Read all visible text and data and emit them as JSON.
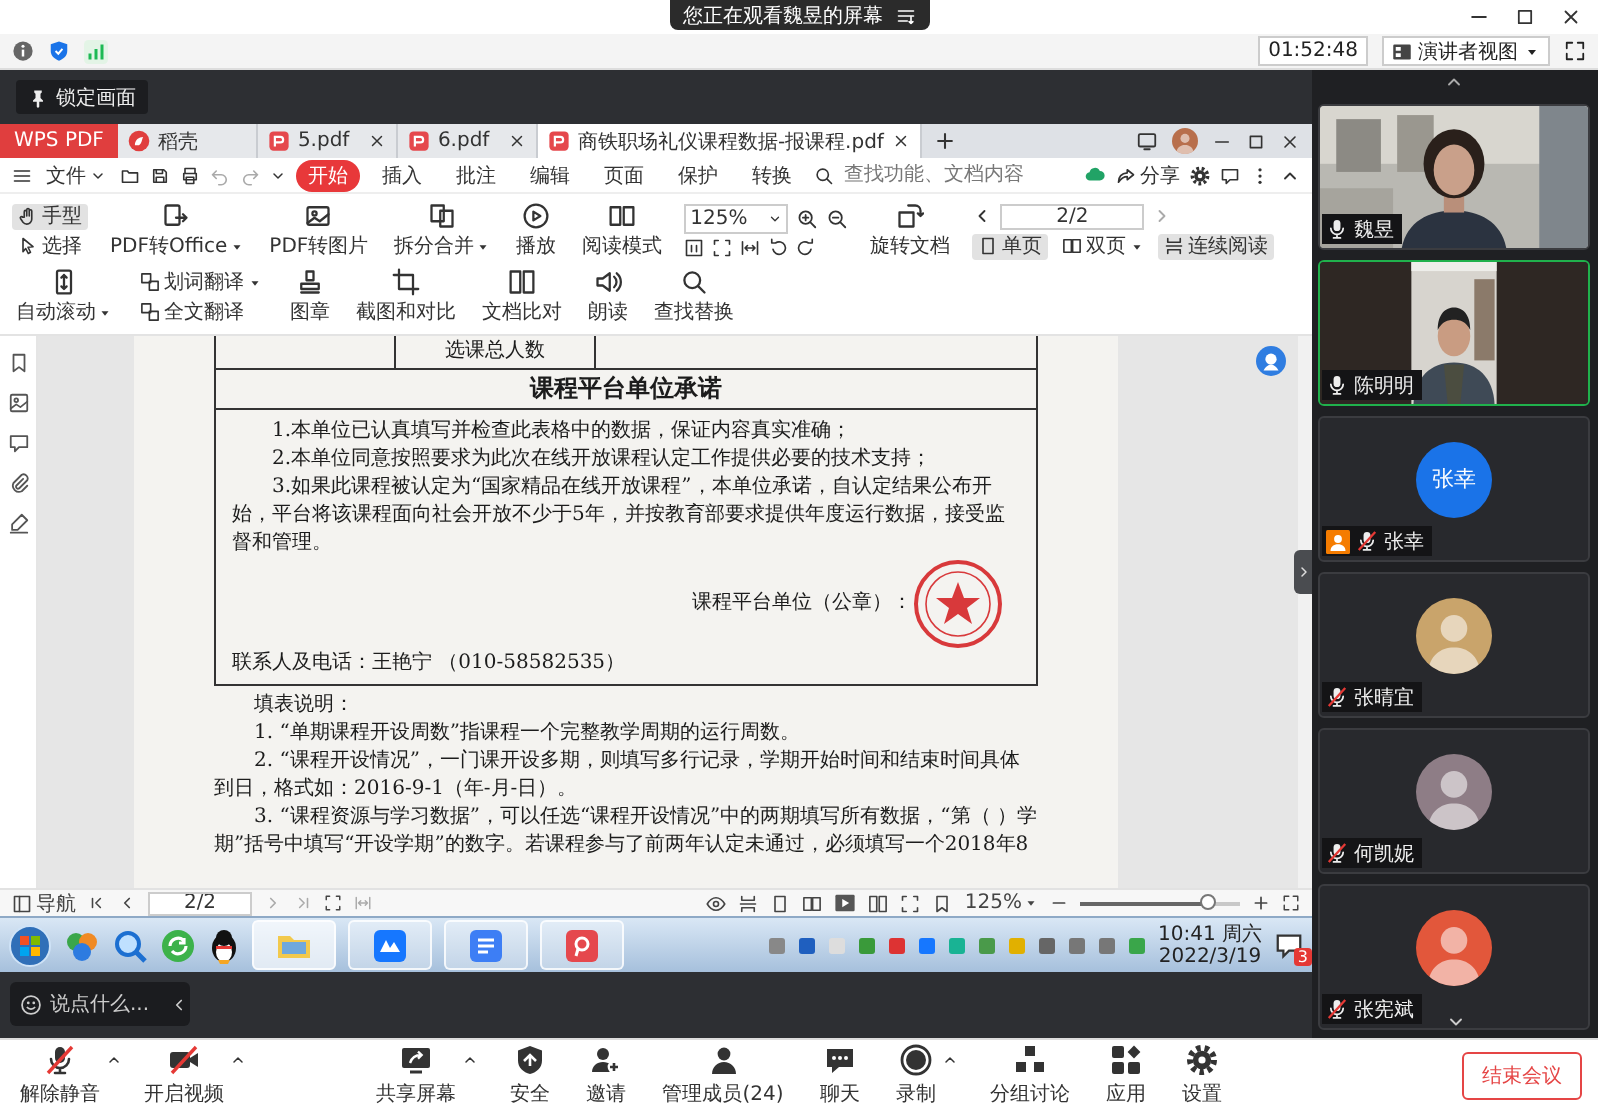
{
  "banner": {
    "text": "您正在观看魏昱的屏幕"
  },
  "meeting_bar": {
    "timer": "01:52:48",
    "view_button": "演讲者视图"
  },
  "pin_button": {
    "label": "锁定画面"
  },
  "shared_screen": {
    "app_button": "WPS PDF",
    "tabs": [
      {
        "label": "稻壳",
        "kind": "store",
        "selected": false
      },
      {
        "label": "5.pdf",
        "kind": "pdf",
        "selected": false
      },
      {
        "label": "6.pdf",
        "kind": "pdf",
        "selected": false
      },
      {
        "label": "商铁职场礼仪课程数据-报课程.pdf",
        "kind": "pdf",
        "selected": true
      }
    ],
    "file_menu": "文件",
    "menu": [
      {
        "label": "开始",
        "selected": true
      },
      {
        "label": "插入",
        "selected": false
      },
      {
        "label": "批注",
        "selected": false
      },
      {
        "label": "编辑",
        "selected": false
      },
      {
        "label": "页面",
        "selected": false
      },
      {
        "label": "保护",
        "selected": false
      },
      {
        "label": "转换",
        "selected": false
      }
    ],
    "search": {
      "placeholder": "查找功能、文档内容"
    },
    "share_button": "分享",
    "ribbon": [
      {
        "kind": "stack",
        "items": [
          {
            "label": "手型",
            "selected": true,
            "caret": false
          },
          {
            "label": "选择",
            "selected": false,
            "caret": false
          }
        ]
      },
      {
        "kind": "large",
        "label": "PDF转Office",
        "caret": true
      },
      {
        "kind": "large",
        "label": "PDF转图片",
        "caret": false
      },
      {
        "kind": "large",
        "label": "拆分合并",
        "caret": true
      },
      {
        "kind": "large",
        "label": "播放",
        "caret": false
      },
      {
        "kind": "large",
        "label": "阅读模式",
        "caret": false
      },
      {
        "kind": "zoom",
        "value": "125%"
      },
      {
        "kind": "large",
        "label": "旋转文档",
        "caret": false
      },
      {
        "kind": "pager",
        "value": "2/2",
        "items": [
          {
            "label": "单页",
            "selected": true,
            "caret": false
          },
          {
            "label": "双页",
            "selected": false,
            "caret": true
          },
          {
            "label": "连续阅读",
            "selected": true,
            "caret": false
          }
        ]
      },
      {
        "kind": "large",
        "label": "自动滚动",
        "caret": true
      },
      {
        "kind": "stack",
        "items": [
          {
            "label": "划词翻译",
            "selected": false,
            "caret": true
          },
          {
            "label": "全文翻译",
            "selected": false,
            "caret": false
          }
        ]
      },
      {
        "kind": "large",
        "label": "图章",
        "caret": false
      },
      {
        "kind": "large",
        "label": "截图和对比",
        "caret": false
      },
      {
        "kind": "large",
        "label": "文档比对",
        "caret": false
      },
      {
        "kind": "large",
        "label": "朗读",
        "caret": false
      },
      {
        "kind": "large",
        "label": "查找替换",
        "caret": false
      }
    ],
    "document": {
      "table_cell": "选课总人数",
      "heading": "课程平台单位承诺",
      "pledges": [
        "1.本单位已认真填写并检查此表格中的数据，保证内容真实准确；",
        "2.本单位同意按照要求为此次在线开放课程认定工作提供必要的技术支持；",
        "3.如果此课程被认定为“国家精品在线开放课程”，本单位承诺，自认定结果公布开始，平台将该课程面向社会开放不少于5年，并按教育部要求提供年度运行数据，接受监督和管理。"
      ],
      "signature": "课程平台单位（公章）：",
      "contact": "联系人及电话：王艳宁 （010-58582535）",
      "notes_title": "填表说明：",
      "notes": [
        "1. “单期课程开设周数”指课程一个完整教学周期的运行周数。",
        "2. “课程开设情况”，一门课开设多期，则填写多行记录，学期开始时间和结束时间具体到日，格式如：2016-9-1（年-月-日）。",
        "3. “课程资源与学习数据”，可以任选“课程开设情况”中的两期填写所有数据，“第（ ）学期”括号中填写“开设学期”的数字。若课程参与了前两年认定未通过，必须填写一个2018年8"
      ]
    },
    "status_bar": {
      "nav": "导航",
      "page": "2/2",
      "zoom": "125%",
      "slider": {
        "level": 0.8
      }
    },
    "taskbar": {
      "time": "10:41 周六",
      "date": "2022/3/19",
      "notification_count": "3"
    }
  },
  "chat_input": {
    "placeholder": "说点什么..."
  },
  "participants": [
    {
      "name": "魏昱",
      "kind": "video",
      "muted": false,
      "host": false,
      "active": false
    },
    {
      "name": "陈明明",
      "kind": "video",
      "muted": false,
      "host": false,
      "active": true
    },
    {
      "name": "张幸",
      "kind": "initials",
      "avatar_text": "张幸",
      "muted": true,
      "host": true,
      "active": false
    },
    {
      "name": "张晴宜",
      "kind": "avatar",
      "muted": true,
      "host": false,
      "active": false
    },
    {
      "name": "何凯妮",
      "kind": "avatar",
      "muted": true,
      "host": false,
      "active": false
    },
    {
      "name": "张宪斌",
      "kind": "avatar",
      "muted": true,
      "host": false,
      "active": false
    }
  ],
  "toolbar": [
    {
      "label": "解除静音",
      "caret": true,
      "crossed_out": true
    },
    {
      "label": "开启视频",
      "caret": true,
      "crossed_out": true
    },
    {
      "label": "共享屏幕",
      "caret": true,
      "crossed_out": false
    },
    {
      "label": "安全",
      "caret": false,
      "crossed_out": false
    },
    {
      "label": "邀请",
      "caret": false,
      "crossed_out": false
    },
    {
      "label": "管理成员(24)",
      "caret": false,
      "crossed_out": false
    },
    {
      "label": "聊天",
      "caret": false,
      "crossed_out": false
    },
    {
      "label": "录制",
      "caret": true,
      "crossed_out": false
    },
    {
      "label": "分组讨论",
      "caret": false,
      "crossed_out": false
    },
    {
      "label": "应用",
      "caret": false,
      "crossed_out": false
    },
    {
      "label": "设置",
      "caret": false,
      "crossed_out": false
    }
  ],
  "end_button": "结束会议"
}
